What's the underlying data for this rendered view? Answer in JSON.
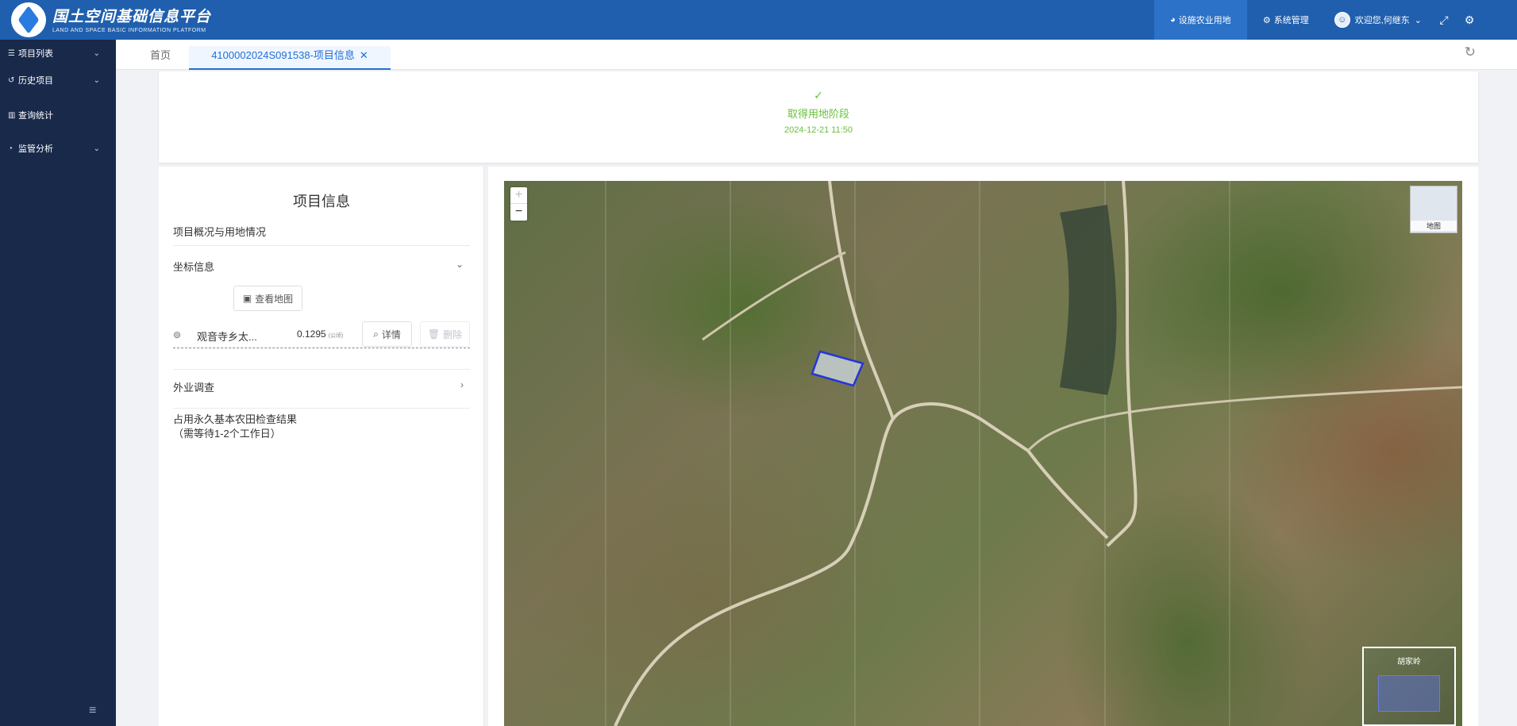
{
  "header": {
    "brand_cn": "国土空间基础信息平台",
    "brand_en": "LAND AND SPACE BASIC INFORMATION PLATFORM",
    "nav_active": "设施农业用地",
    "nav_system": "系统管理",
    "user_greeting": "欢迎您,何继东"
  },
  "sidebar": {
    "items": [
      {
        "label": "项目列表"
      },
      {
        "label": "历史项目"
      },
      {
        "label": "查询统计"
      },
      {
        "label": "监管分析"
      }
    ]
  },
  "tabs": {
    "home": "首页",
    "active": "4100002024S091538-项目信息"
  },
  "step": {
    "label": "取得用地阶段",
    "time": "2024-12-21 11:50"
  },
  "info": {
    "title": "项目信息",
    "overview": "项目概况与用地情况",
    "coords_title": "坐标信息",
    "view_map_btn": "查看地图",
    "coord_name": "观音寺乡太...",
    "coord_area": "0.1295",
    "coord_unit": "(公顷)",
    "detail_btn": "详情",
    "delete_btn": "删除",
    "field_survey": "外业调查",
    "check_result": "占用永久基本农田检查结果",
    "check_wait": "（需等待1-2个工作日）"
  },
  "map": {
    "zoom_in": "+",
    "zoom_out": "−",
    "basemap_label": "地图",
    "overview_label": "胡家岭"
  }
}
